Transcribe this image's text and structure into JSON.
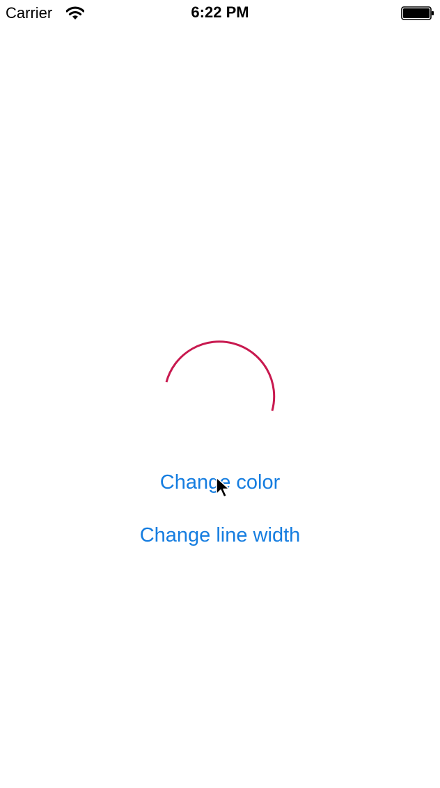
{
  "status_bar": {
    "carrier": "Carrier",
    "time": "6:22 PM",
    "wifi_icon": "wifi-icon",
    "battery_icon": "battery-icon"
  },
  "progress_arc": {
    "color": "#c8194f"
  },
  "buttons": {
    "change_color": "Change color",
    "change_line_width": "Change line width"
  },
  "accent_color": "#157de0",
  "cursor_icon": "pointer-cursor-icon"
}
